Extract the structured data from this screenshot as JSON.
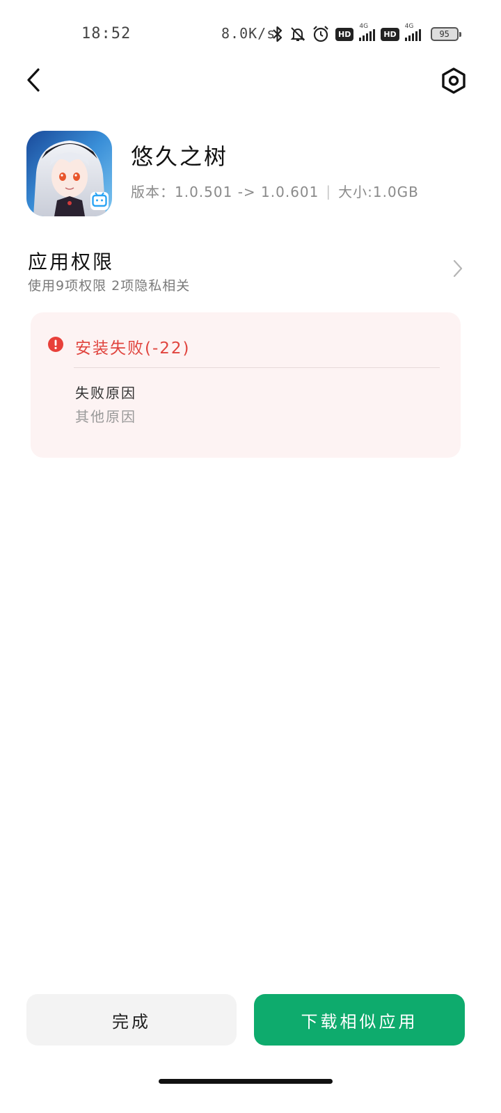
{
  "status_bar": {
    "time": "18:52",
    "net_speed": "8.0K/s",
    "hd_label": "HD",
    "network_type": "4G",
    "battery": "95",
    "icons": [
      "bluetooth-icon",
      "mute-bell-icon",
      "alarm-icon",
      "hd-icon",
      "signal-icon",
      "hd-icon",
      "signal-icon",
      "battery-icon"
    ]
  },
  "toolbar": {
    "back_icon": "chevron-left-icon",
    "settings_icon": "hexagon-gear-icon"
  },
  "app": {
    "name": "悠久之树",
    "version_label": "版本：1.0.501 -> 1.0.601",
    "separator": "|",
    "size_label": "大小:1.0GB"
  },
  "permissions": {
    "title": "应用权限",
    "summary": "使用9项权限 2项隐私相关"
  },
  "error": {
    "title": "安装失败(-22)",
    "reason_label": "失败原因",
    "reason_value": "其他原因"
  },
  "buttons": {
    "done": "完成",
    "download_similar": "下载相似应用"
  },
  "colors": {
    "error_red": "#e0443e",
    "card_bg": "#fdf3f3",
    "primary_green": "#0eab6d",
    "secondary_btn_bg": "#f3f3f3"
  }
}
